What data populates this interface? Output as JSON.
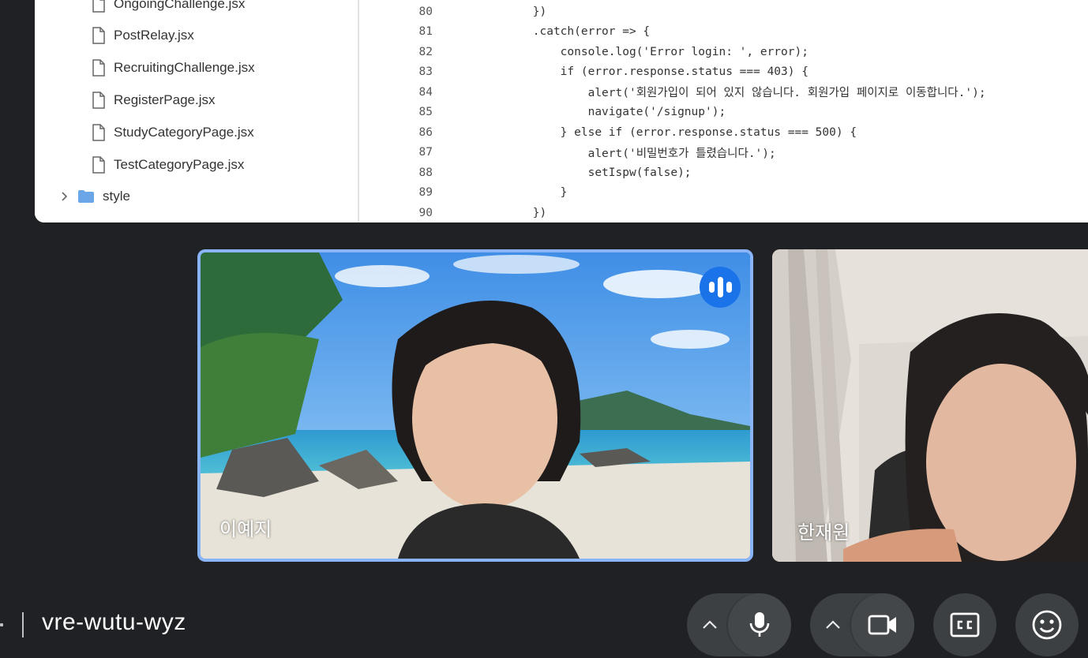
{
  "shared_screen": {
    "explorer": {
      "files": [
        "OngoingChallenge.jsx",
        "PostRelay.jsx",
        "RecruitingChallenge.jsx",
        "RegisterPage.jsx",
        "StudyCategoryPage.jsx",
        "TestCategoryPage.jsx"
      ],
      "folder": "style"
    },
    "code_lines": [
      {
        "n": "80",
        "text": "            })"
      },
      {
        "n": "81",
        "text": "            .catch(error => {"
      },
      {
        "n": "82",
        "text": "                console.log('Error login: ', error);"
      },
      {
        "n": "83",
        "text": "                if (error.response.status === 403) {"
      },
      {
        "n": "84",
        "text": "                    alert('회원가입이 되어 있지 않습니다. 회원가입 페이지로 이동합니다.');"
      },
      {
        "n": "85",
        "text": "                    navigate('/signup');"
      },
      {
        "n": "86",
        "text": "                } else if (error.response.status === 500) {"
      },
      {
        "n": "87",
        "text": "                    alert('비밀번호가 틀렸습니다.');"
      },
      {
        "n": "88",
        "text": "                    setIspw(false);"
      },
      {
        "n": "89",
        "text": "                }"
      },
      {
        "n": "90",
        "text": "            })"
      }
    ]
  },
  "participants": [
    {
      "name": "이예지",
      "speaking": true
    },
    {
      "name": "한재원",
      "speaking": false
    }
  ],
  "meeting": {
    "code": "vre-wutu-wyz"
  },
  "controls": {
    "mic_options_icon": "chevron-up-icon",
    "mic_icon": "microphone-icon",
    "camera_options_icon": "chevron-up-icon",
    "camera_icon": "videocam-icon",
    "captions_icon": "closed-captions-icon",
    "reactions_icon": "emoji-icon"
  },
  "colors": {
    "background": "#202124",
    "control": "#3c4043",
    "speaking_border": "#8ab4f8",
    "speaking_badge": "#1a73e8"
  }
}
